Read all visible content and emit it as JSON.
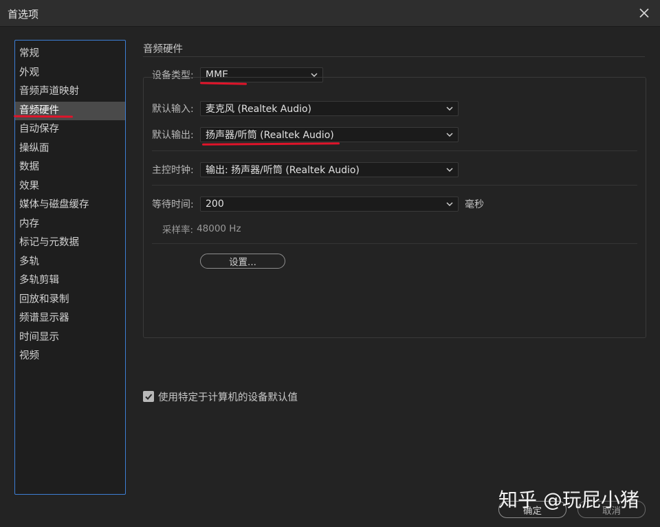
{
  "window": {
    "title": "首选项"
  },
  "sidebar": {
    "items": [
      {
        "label": "常规"
      },
      {
        "label": "外观"
      },
      {
        "label": "音频声道映射"
      },
      {
        "label": "音频硬件",
        "selected": true
      },
      {
        "label": "自动保存"
      },
      {
        "label": "操纵面"
      },
      {
        "label": "数据"
      },
      {
        "label": "效果"
      },
      {
        "label": "媒体与磁盘缓存"
      },
      {
        "label": "内存"
      },
      {
        "label": "标记与元数据"
      },
      {
        "label": "多轨"
      },
      {
        "label": "多轨剪辑"
      },
      {
        "label": "回放和录制"
      },
      {
        "label": "频谱显示器"
      },
      {
        "label": "时间显示"
      },
      {
        "label": "视频"
      }
    ]
  },
  "main": {
    "section_title": "音频硬件",
    "device_type": {
      "label": "设备类型:",
      "value": "MME"
    },
    "default_input": {
      "label": "默认输入:",
      "value": "麦克风 (Realtek Audio)"
    },
    "default_output": {
      "label": "默认输出:",
      "value": "扬声器/听筒 (Realtek Audio)"
    },
    "master_clock": {
      "label": "主控时钟:",
      "value": "输出: 扬声器/听筒 (Realtek Audio)"
    },
    "latency": {
      "label": "等待时间:",
      "value": "200",
      "unit": "毫秒"
    },
    "sample_rate": {
      "label": "采样率:",
      "value": "48000 Hz"
    },
    "settings_button": "设置..."
  },
  "use_default_checkbox": {
    "label": "使用特定于计算机的设备默认值",
    "checked": true
  },
  "footer": {
    "ok_label": "确定",
    "cancel_label": "取消"
  },
  "watermark": "知乎 @玩屁小猪",
  "colors": {
    "accent_border": "#3d7fd6",
    "annotation_red": "#e1142a",
    "background": "#232323"
  }
}
